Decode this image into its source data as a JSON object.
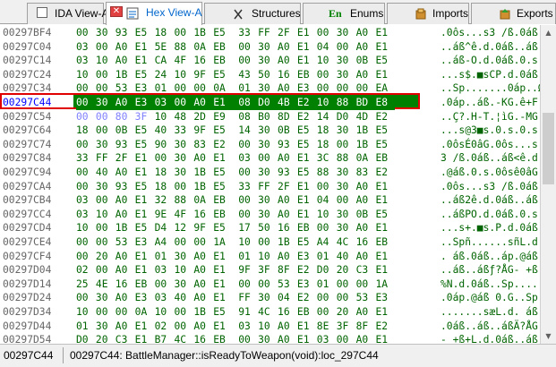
{
  "tabs": [
    {
      "label": "IDA View-A",
      "icon": "graph-view-icon",
      "active": false
    },
    {
      "label": "Hex View-A",
      "icon": "hex-view-icon",
      "active": true,
      "close_label": "✕"
    },
    {
      "label": "Structures",
      "icon": "struct-icon",
      "active": false
    },
    {
      "label": "Enums",
      "icon": "enum-icon",
      "icon_text": "En",
      "active": false
    },
    {
      "label": "Imports",
      "icon": "imports-icon",
      "active": false
    },
    {
      "label": "Exports",
      "icon": "exports-icon",
      "active": false
    }
  ],
  "hex_rows": [
    {
      "addr": "00297BF4",
      "bytes": [
        "00",
        "30",
        "93",
        "E5",
        "18",
        "00",
        "1B",
        "E5",
        "33",
        "FF",
        "2F",
        "E1",
        "00",
        "30",
        "A0",
        "E1"
      ],
      "ascii": ".0ôs...s3 /ß.0áß"
    },
    {
      "addr": "00297C04",
      "bytes": [
        "03",
        "00",
        "A0",
        "E1",
        "5E",
        "88",
        "0A",
        "EB",
        "00",
        "30",
        "A0",
        "E1",
        "04",
        "00",
        "A0",
        "E1"
      ],
      "ascii": "..áß^ê.d.0áß..áß"
    },
    {
      "addr": "00297C14",
      "bytes": [
        "03",
        "10",
        "A0",
        "E1",
        "CA",
        "4F",
        "16",
        "EB",
        "00",
        "30",
        "A0",
        "E1",
        "10",
        "30",
        "0B",
        "E5"
      ],
      "ascii": "..áß-O.d.0áß.0.s"
    },
    {
      "addr": "00297C24",
      "bytes": [
        "10",
        "00",
        "1B",
        "E5",
        "24",
        "10",
        "9F",
        "E5",
        "43",
        "50",
        "16",
        "EB",
        "00",
        "30",
        "A0",
        "E1"
      ],
      "ascii": "...s$.■sCP.d.0áß"
    },
    {
      "addr": "00297C34",
      "bytes": [
        "00",
        "00",
        "53",
        "E3",
        "01",
        "00",
        "00",
        "0A",
        "01",
        "30",
        "A0",
        "E3",
        "00",
        "00",
        "00",
        "EA"
      ],
      "ascii": "..Sp.......0áp..Ω"
    },
    {
      "addr": "00297C44",
      "bytes": [
        "00",
        "30",
        "A0",
        "E3",
        "03",
        "00",
        "A0",
        "E1",
        "08",
        "D0",
        "4B",
        "E2",
        "10",
        "88",
        "BD",
        "E8"
      ],
      "ascii": ".0áp..áß.-KG.ê+F",
      "selected": true
    },
    {
      "addr": "00297C54",
      "bytes": [
        "00",
        "00",
        "80",
        "3F",
        "10",
        "48",
        "2D",
        "E9",
        "08",
        "B0",
        "8D",
        "E2",
        "14",
        "D0",
        "4D",
        "E2"
      ],
      "ascii": "..Ç?.H-T.¦ìG.-MG",
      "unexplored": 4
    },
    {
      "addr": "00297C64",
      "bytes": [
        "18",
        "00",
        "0B",
        "E5",
        "40",
        "33",
        "9F",
        "E5",
        "14",
        "30",
        "0B",
        "E5",
        "18",
        "30",
        "1B",
        "E5"
      ],
      "ascii": "...s@3■s.0.s.0.s"
    },
    {
      "addr": "00297C74",
      "bytes": [
        "00",
        "30",
        "93",
        "E5",
        "90",
        "30",
        "83",
        "E2",
        "00",
        "30",
        "93",
        "E5",
        "18",
        "00",
        "1B",
        "E5"
      ],
      "ascii": ".0ôsÉ0âG.0ôs...s"
    },
    {
      "addr": "00297C84",
      "bytes": [
        "33",
        "FF",
        "2F",
        "E1",
        "00",
        "30",
        "A0",
        "E1",
        "03",
        "00",
        "A0",
        "E1",
        "3C",
        "88",
        "0A",
        "EB"
      ],
      "ascii": "3 /ß.0áß..áß<ê.d"
    },
    {
      "addr": "00297C94",
      "bytes": [
        "00",
        "40",
        "A0",
        "E1",
        "18",
        "30",
        "1B",
        "E5",
        "00",
        "30",
        "93",
        "E5",
        "88",
        "30",
        "83",
        "E2"
      ],
      "ascii": ".@áß.0.s.0ôsê0âG"
    },
    {
      "addr": "00297CA4",
      "bytes": [
        "00",
        "30",
        "93",
        "E5",
        "18",
        "00",
        "1B",
        "E5",
        "33",
        "FF",
        "2F",
        "E1",
        "00",
        "30",
        "A0",
        "E1"
      ],
      "ascii": ".0ôs...s3 /ß.0áß"
    },
    {
      "addr": "00297CB4",
      "bytes": [
        "03",
        "00",
        "A0",
        "E1",
        "32",
        "88",
        "0A",
        "EB",
        "00",
        "30",
        "A0",
        "E1",
        "04",
        "00",
        "A0",
        "E1"
      ],
      "ascii": "..áß2ê.d.0áß..áß"
    },
    {
      "addr": "00297CC4",
      "bytes": [
        "03",
        "10",
        "A0",
        "E1",
        "9E",
        "4F",
        "16",
        "EB",
        "00",
        "30",
        "A0",
        "E1",
        "10",
        "30",
        "0B",
        "E5"
      ],
      "ascii": "..áßPO.d.0áß.0.s"
    },
    {
      "addr": "00297CD4",
      "bytes": [
        "10",
        "00",
        "1B",
        "E5",
        "D4",
        "12",
        "9F",
        "E5",
        "17",
        "50",
        "16",
        "EB",
        "00",
        "30",
        "A0",
        "E1"
      ],
      "ascii": "...s+.■s.P.d.0áß"
    },
    {
      "addr": "00297CE4",
      "bytes": [
        "00",
        "00",
        "53",
        "E3",
        "A4",
        "00",
        "00",
        "1A",
        "10",
        "00",
        "1B",
        "E5",
        "A4",
        "4C",
        "16",
        "EB"
      ],
      "ascii": "..Spñ......sñL.d"
    },
    {
      "addr": "00297CF4",
      "bytes": [
        "00",
        "20",
        "A0",
        "E1",
        "01",
        "30",
        "A0",
        "E1",
        "01",
        "10",
        "A0",
        "E3",
        "01",
        "40",
        "A0",
        "E1"
      ],
      "ascii": ". áß.0áß..áp.@áß"
    },
    {
      "addr": "00297D04",
      "bytes": [
        "02",
        "00",
        "A0",
        "E1",
        "03",
        "10",
        "A0",
        "E1",
        "9F",
        "3F",
        "8F",
        "E2",
        "D0",
        "20",
        "C3",
        "E1"
      ],
      "ascii": "..áß..áßƒ?ÅG- +ß"
    },
    {
      "addr": "00297D14",
      "bytes": [
        "25",
        "4E",
        "16",
        "EB",
        "00",
        "30",
        "A0",
        "E1",
        "00",
        "00",
        "53",
        "E3",
        "01",
        "00",
        "00",
        "1A"
      ],
      "ascii": "%N.d.0áß..Sp...."
    },
    {
      "addr": "00297D24",
      "bytes": [
        "00",
        "30",
        "A0",
        "E3",
        "03",
        "40",
        "A0",
        "E1",
        "FF",
        "30",
        "04",
        "E2",
        "00",
        "00",
        "53",
        "E3"
      ],
      "ascii": ".0áp.@áß 0.G..Sp"
    },
    {
      "addr": "00297D34",
      "bytes": [
        "10",
        "00",
        "00",
        "0A",
        "10",
        "00",
        "1B",
        "E5",
        "91",
        "4C",
        "16",
        "EB",
        "00",
        "20",
        "A0",
        "E1"
      ],
      "ascii": ".......sæL.d. áß"
    },
    {
      "addr": "00297D44",
      "bytes": [
        "01",
        "30",
        "A0",
        "E1",
        "02",
        "00",
        "A0",
        "E1",
        "03",
        "10",
        "A0",
        "E1",
        "8E",
        "3F",
        "8F",
        "E2"
      ],
      "ascii": ".0áß..áß..áßÄ?ÅG"
    },
    {
      "addr": "00297D54",
      "bytes": [
        "D0",
        "20",
        "C3",
        "E1",
        "B7",
        "4C",
        "16",
        "EB",
        "00",
        "30",
        "A0",
        "E1",
        "03",
        "00",
        "A0",
        "E1"
      ],
      "ascii": "- +ß+L.d.0áß..áß"
    }
  ],
  "status": {
    "offset": "00297C44",
    "location": "00297C44: BattleManager::isReadyToWeapon(void):loc_297C44"
  },
  "colors": {
    "hex_green": "#006400",
    "selection_red": "#e00000",
    "selected_addr": "#0000ff",
    "highlight_bg": "#008000"
  }
}
